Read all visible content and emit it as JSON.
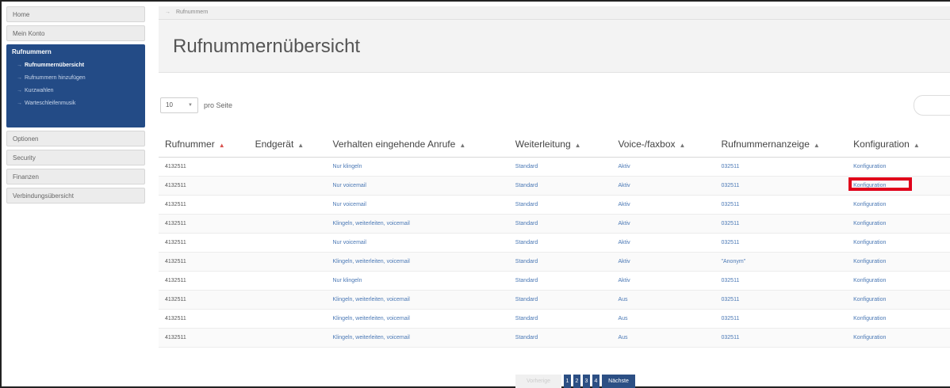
{
  "sidebar": {
    "home": "Home",
    "account": "Mein Konto",
    "group_title": "Rufnummern",
    "sub_items": [
      {
        "label": "Rufnummernübersicht",
        "active": true
      },
      {
        "label": "Rufnummern hinzufügen",
        "active": false
      },
      {
        "label": "Kurzwahlen",
        "active": false
      },
      {
        "label": "Warteschleifenmusik",
        "active": false
      }
    ],
    "items_after": [
      "Optionen",
      "Security",
      "Finanzen",
      "Verbindungsübersicht"
    ]
  },
  "breadcrumb": {
    "current": "Rufnummern"
  },
  "header": {
    "title": "Rufnummernübersicht"
  },
  "controls": {
    "per_page_value": "10",
    "per_page_label": "pro Seite"
  },
  "table": {
    "columns": [
      "Rufnummer",
      "Endgerät",
      "Verhalten eingehende Anrufe",
      "Weiterleitung",
      "Voice-/faxbox",
      "Rufnummernanzeige",
      "Konfiguration"
    ],
    "rows": [
      {
        "number": "4132511",
        "device": "",
        "behavior": "Nur klingeln",
        "forwarding": "Standard",
        "voicebox": "Aktiv",
        "display": "032511",
        "config": "Konfiguration"
      },
      {
        "number": "4132511",
        "device": "",
        "behavior": "Nur voicemail",
        "forwarding": "Standard",
        "voicebox": "Aktiv",
        "display": "032511",
        "config": "Konfiguration"
      },
      {
        "number": "4132511",
        "device": "",
        "behavior": "Nur voicemail",
        "forwarding": "Standard",
        "voicebox": "Aktiv",
        "display": "032511",
        "config": "Konfiguration"
      },
      {
        "number": "4132511",
        "device": "",
        "behavior": "Klingeln, weiterleiten, voicemail",
        "forwarding": "Standard",
        "voicebox": "Aktiv",
        "display": "032511",
        "config": "Konfiguration"
      },
      {
        "number": "4132511",
        "device": "",
        "behavior": "Nur voicemail",
        "forwarding": "Standard",
        "voicebox": "Aktiv",
        "display": "032511",
        "config": "Konfiguration"
      },
      {
        "number": "4132511",
        "device": "",
        "behavior": "Klingeln, weiterleiten, voicemail",
        "forwarding": "Standard",
        "voicebox": "Aktiv",
        "display": "\"Anonym\"",
        "config": "Konfiguration"
      },
      {
        "number": "4132511",
        "device": "",
        "behavior": "Nur klingeln",
        "forwarding": "Standard",
        "voicebox": "Aktiv",
        "display": "032511",
        "config": "Konfiguration"
      },
      {
        "number": "4132511",
        "device": "",
        "behavior": "Klingeln, weiterleiten, voicemail",
        "forwarding": "Standard",
        "voicebox": "Aus",
        "display": "032511",
        "config": "Konfiguration"
      },
      {
        "number": "4132511",
        "device": "",
        "behavior": "Klingeln, weiterleiten, voicemail",
        "forwarding": "Standard",
        "voicebox": "Aus",
        "display": "032511",
        "config": "Konfiguration"
      },
      {
        "number": "4132511",
        "device": "",
        "behavior": "Klingeln, weiterleiten, voicemail",
        "forwarding": "Standard",
        "voicebox": "Aus",
        "display": "032511",
        "config": "Konfiguration"
      }
    ]
  },
  "pagination": {
    "prev": "Vorherige",
    "pages": [
      "1",
      "2",
      "3",
      "4"
    ],
    "next": "Nächste"
  },
  "colors": {
    "nav_active": "#234b86",
    "link": "#4a78b5",
    "highlight": "#e0001a",
    "pager": "#2c4f84"
  }
}
